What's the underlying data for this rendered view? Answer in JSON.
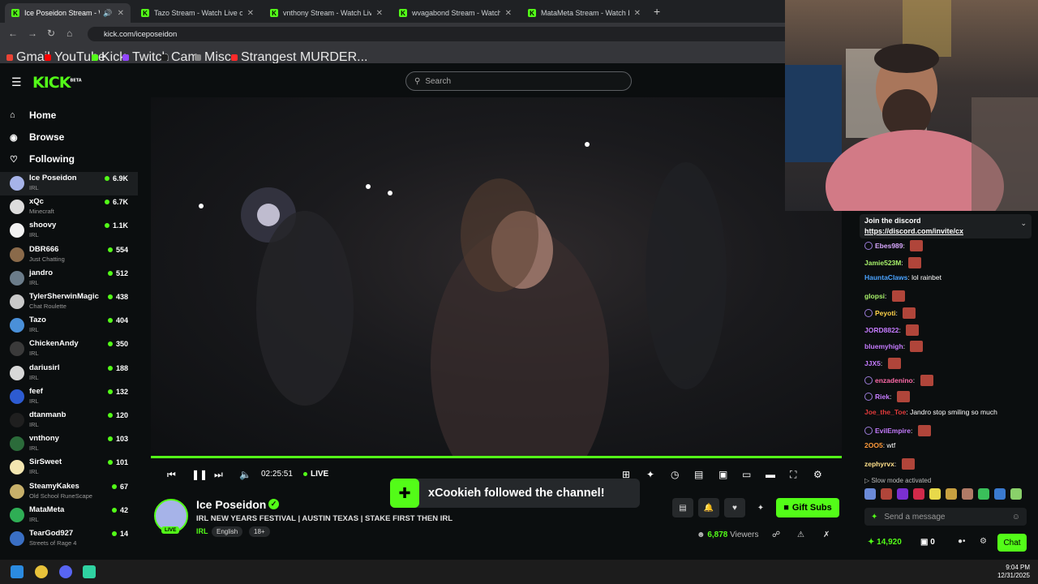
{
  "browser": {
    "tabs": [
      {
        "title": "Ice Poseidon Stream - Watc",
        "active": true
      },
      {
        "title": "Tazo Stream - Watch Live on Ki",
        "active": false
      },
      {
        "title": "vnthony Stream - Watch Live o",
        "active": false
      },
      {
        "title": "wvagabond Stream - Watch Li",
        "active": false
      },
      {
        "title": "MataMeta Stream - Watch Live",
        "active": false
      }
    ],
    "url": "kick.com/iceposeidon",
    "bookmarks": [
      "Gmail",
      "YouTube",
      "Kick",
      "Twitch",
      "Cam",
      "Misc",
      "Strangest MURDER..."
    ]
  },
  "site": {
    "logo": "KICK",
    "logo_sup": "BETA",
    "search_placeholder": "Search",
    "nav": [
      "Home",
      "Browse",
      "Following"
    ]
  },
  "channels": [
    {
      "name": "Ice Poseidon",
      "category": "IRL",
      "viewers": "6.9K",
      "color": "#a6b3e8"
    },
    {
      "name": "xQc",
      "category": "Minecraft",
      "viewers": "6.7K",
      "color": "#dcdcdc"
    },
    {
      "name": "shoovy",
      "category": "IRL",
      "viewers": "1.1K",
      "color": "#f2f2f2"
    },
    {
      "name": "DBR666",
      "category": "Just Chatting",
      "viewers": "554",
      "color": "#8a6a4a"
    },
    {
      "name": "jandro",
      "category": "IRL",
      "viewers": "512",
      "color": "#6b7c8a"
    },
    {
      "name": "TylerSherwinMagic",
      "category": "Chat Roulette",
      "viewers": "438",
      "color": "#c9c9c9"
    },
    {
      "name": "Tazo",
      "category": "IRL",
      "viewers": "404",
      "color": "#4a90d9"
    },
    {
      "name": "ChickenAndy",
      "category": "IRL",
      "viewers": "350",
      "color": "#3a3a3a"
    },
    {
      "name": "dariusirl",
      "category": "IRL",
      "viewers": "188",
      "color": "#d8d8d8"
    },
    {
      "name": "feef",
      "category": "IRL",
      "viewers": "132",
      "color": "#2d5bd1"
    },
    {
      "name": "dtanmanb",
      "category": "IRL",
      "viewers": "120",
      "color": "#1f1f1f"
    },
    {
      "name": "vnthony",
      "category": "IRL",
      "viewers": "103",
      "color": "#2b6b3a"
    },
    {
      "name": "SirSweet",
      "category": "IRL",
      "viewers": "101",
      "color": "#f3e6b0"
    },
    {
      "name": "SteamyKakes",
      "category": "Old School RuneScape",
      "viewers": "67",
      "color": "#c7b06a"
    },
    {
      "name": "MataMeta",
      "category": "IRL",
      "viewers": "42",
      "color": "#2fae55"
    },
    {
      "name": "TearGod927",
      "category": "Streets of Rage 4",
      "viewers": "14",
      "color": "#3a6fc4"
    }
  ],
  "player": {
    "time": "02:25:51",
    "live_label": "LIVE"
  },
  "stream": {
    "channel_name": "Ice Poseidon",
    "live_badge": "LIVE",
    "title": "IRL NEW YEARS FESTIVAL | AUSTIN TEXAS | STAKE FIRST THEN IRL",
    "category": "IRL",
    "tags": [
      "English",
      "18+"
    ],
    "viewers": "6,878",
    "viewers_label": "Viewers",
    "gift_subs_label": "Gift Subs"
  },
  "toast": {
    "message": "xCookieh followed the channel!"
  },
  "chat": {
    "pinned_title": "Join the discord",
    "pinned_link": "https://discord.com/invite/cx",
    "messages": [
      {
        "user": "Ebes989",
        "color": "#d9a8ff",
        "text": "",
        "emote": true,
        "badge": true
      },
      {
        "user": "Jamie523M",
        "color": "#a7f06a",
        "text": "",
        "emote": true,
        "badge": false
      },
      {
        "user": "HauntaClaws",
        "color": "#4aa3ff",
        "text": "lol rainbet",
        "emote": false,
        "badge": false
      },
      {
        "user": "glopsi",
        "color": "#a7f06a",
        "text": "",
        "emote": true,
        "badge": false
      },
      {
        "user": "Peyoti",
        "color": "#ffd34a",
        "text": "",
        "emote": true,
        "badge": true
      },
      {
        "user": "JORD8822",
        "color": "#c57bff",
        "text": "",
        "emote": true,
        "badge": false
      },
      {
        "user": "bluemyhigh",
        "color": "#c57bff",
        "text": "",
        "emote": true,
        "badge": false
      },
      {
        "user": "JJX5",
        "color": "#c57bff",
        "text": "",
        "emote": true,
        "badge": false
      },
      {
        "user": "enzadenino",
        "color": "#ff6aa8",
        "text": "",
        "emote": true,
        "badge": true
      },
      {
        "user": "Riek",
        "color": "#c57bff",
        "text": "",
        "emote": true,
        "badge": true
      },
      {
        "user": "Joe_the_Toe",
        "color": "#e03a3a",
        "text": "Jandro stop smiling so much",
        "emote": false,
        "badge": false
      },
      {
        "user": "EvilEmpire",
        "color": "#c57bff",
        "text": "",
        "emote": true,
        "badge": true
      },
      {
        "user": "2OO5",
        "color": "#ff9a3a",
        "text": "wtf",
        "emote": false,
        "badge": false
      },
      {
        "user": "zephyrvx",
        "color": "#ffe08a",
        "text": "",
        "emote": true,
        "badge": false
      }
    ],
    "slow_mode": "Slow mode activated",
    "input_placeholder": "Send a message",
    "points": "14,920",
    "second_count": "0",
    "chat_button": "Chat"
  },
  "taskbar": {
    "time": "9:04 PM",
    "date": "12/31/2025"
  }
}
